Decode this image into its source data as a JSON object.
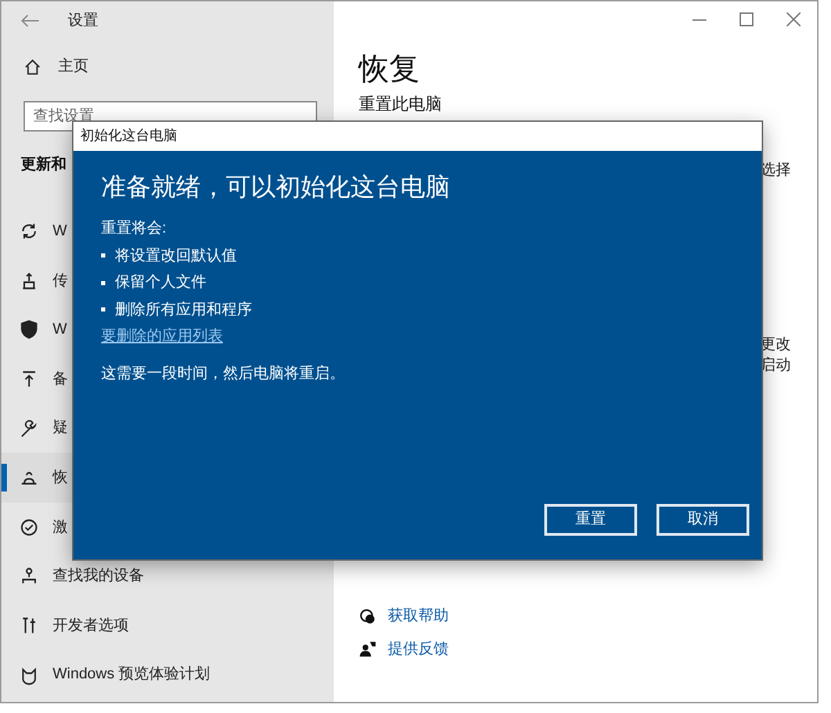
{
  "window": {
    "title": "设置"
  },
  "sidebar": {
    "home": "主页",
    "search": {
      "placeholder": "查找设置"
    },
    "section": "更新和",
    "items": [
      {
        "label": "W",
        "selected": false
      },
      {
        "label": "传",
        "selected": false
      },
      {
        "label": "W",
        "selected": false
      },
      {
        "label": "备",
        "selected": false
      },
      {
        "label": "疑",
        "selected": false
      },
      {
        "label": "恢",
        "selected": true
      },
      {
        "label": "激",
        "selected": false
      },
      {
        "label": "查找我的设备",
        "selected": false
      },
      {
        "label": "开发者选项",
        "selected": false
      },
      {
        "label": "Windows 预览体验计划",
        "selected": false
      }
    ]
  },
  "content": {
    "title": "恢复",
    "subtitle": "重置此电脑",
    "fragments": [
      "选择",
      "更改",
      "启动"
    ],
    "links": [
      "获取帮助",
      "提供反馈"
    ]
  },
  "dialog": {
    "title": "初始化这台电脑",
    "heading": "准备就绪，可以初始化这台电脑",
    "intro": "重置将会:",
    "bullets": [
      "将设置改回默认值",
      "保留个人文件",
      "删除所有应用和程序"
    ],
    "link": "要删除的应用列表",
    "note": "这需要一段时间，然后电脑将重启。",
    "buttons": [
      "重置",
      "取消"
    ]
  }
}
